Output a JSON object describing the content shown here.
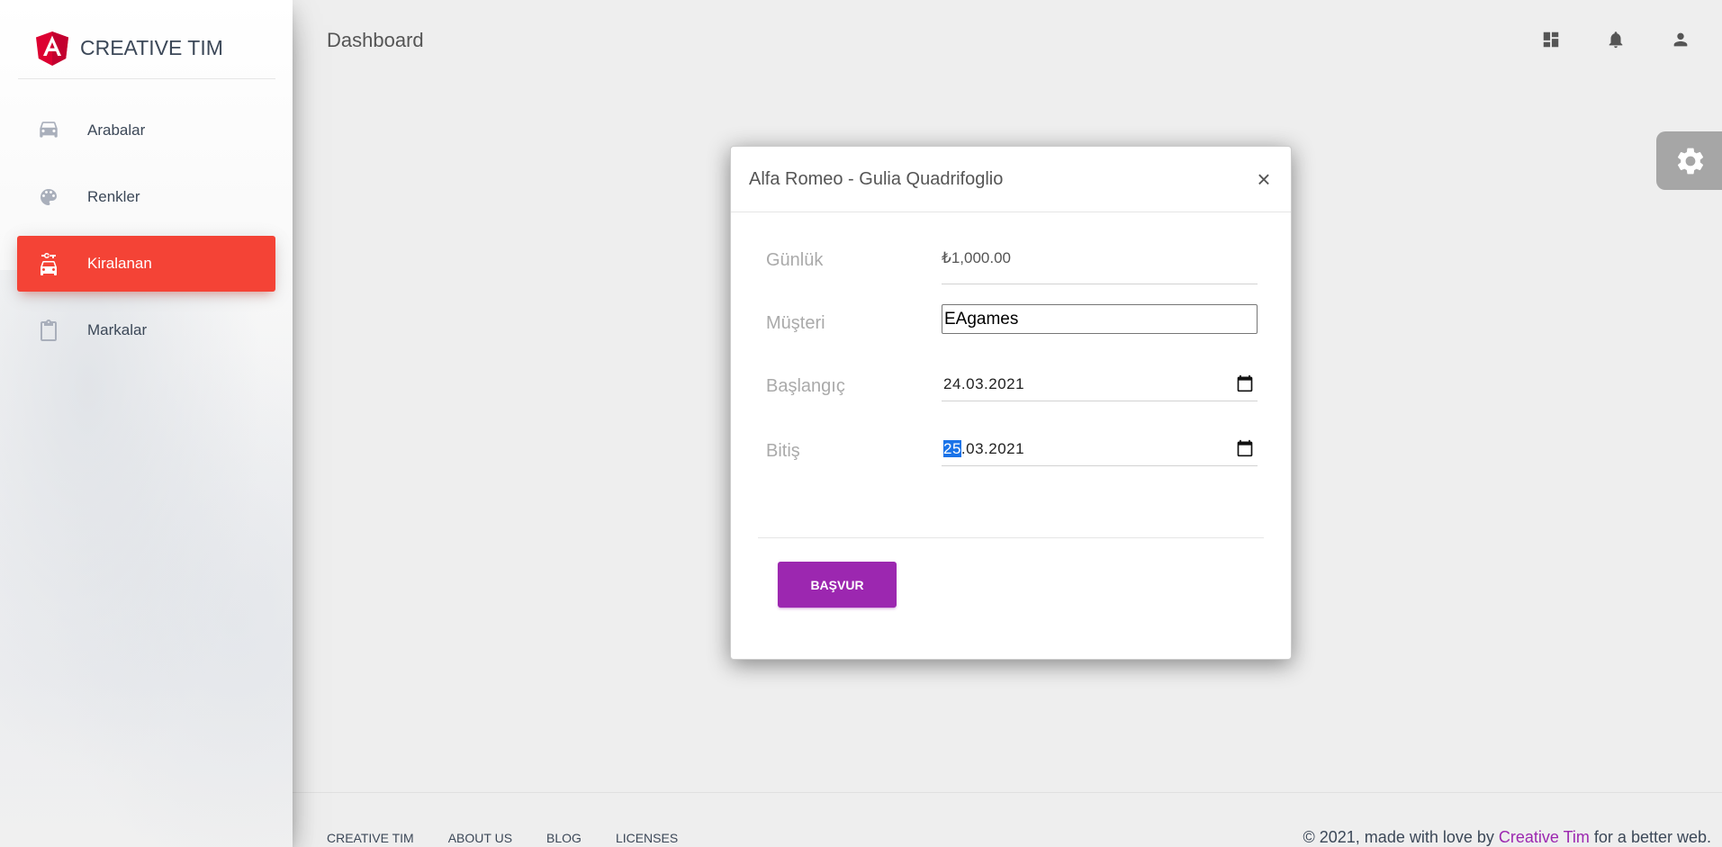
{
  "sidebar": {
    "brand": "CREATIVE TIM",
    "items": [
      {
        "label": "Arabalar",
        "icon": "car-icon",
        "active": false
      },
      {
        "label": "Renkler",
        "icon": "palette-icon",
        "active": false
      },
      {
        "label": "Kiralanan",
        "icon": "car-rental-icon",
        "active": true
      },
      {
        "label": "Markalar",
        "icon": "clipboard-icon",
        "active": false
      }
    ]
  },
  "topbar": {
    "title": "Dashboard",
    "icons": [
      "dashboard-icon",
      "bell-icon",
      "person-icon"
    ]
  },
  "modal": {
    "title": "Alfa Romeo - Gulia Quadrifoglio",
    "close": "×",
    "fields": {
      "daily_label": "Günlük",
      "daily_value": "₺1,000.00",
      "customer_label": "Müşteri",
      "customer_value": "EAgames",
      "start_label": "Başlangıç",
      "start_value": "24.03.2021",
      "end_label": "Bitiş",
      "end_day": "25",
      "end_rest": ".03.2021"
    },
    "submit_label": "BAŞVUR"
  },
  "footer": {
    "links": [
      "CREATIVE TIM",
      "ABOUT US",
      "BLOG",
      "LICENSES"
    ],
    "copyright_prefix": "© 2021, made with love by ",
    "copyright_brand": "Creative Tim",
    "copyright_suffix": " for a better web."
  },
  "colors": {
    "accent_active": "#f44336",
    "primary_button": "#9c27b0",
    "selection": "#1a73e8"
  }
}
